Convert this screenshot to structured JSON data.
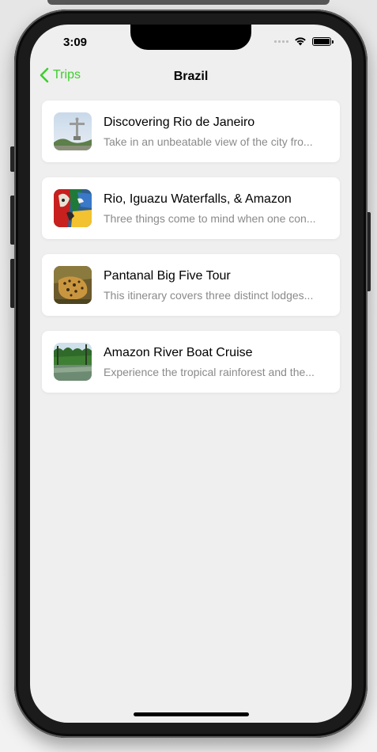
{
  "status_bar": {
    "time": "3:09"
  },
  "nav": {
    "back_label": "Trips",
    "title": "Brazil"
  },
  "trips": [
    {
      "title": "Discovering Rio de Janeiro",
      "description": "Take in an unbeatable view of the city fro...",
      "thumbnail": "christ-the-redeemer-image"
    },
    {
      "title": "Rio, Iguazu Waterfalls, & Amazon",
      "description": "Three things come to mind when one con...",
      "thumbnail": "macaw-parrots-image"
    },
    {
      "title": "Pantanal Big Five Tour",
      "description": "This itinerary covers three distinct lodges...",
      "thumbnail": "jaguar-image"
    },
    {
      "title": "Amazon River Boat Cruise",
      "description": "Experience the tropical rainforest and the...",
      "thumbnail": "amazon-river-image"
    }
  ],
  "colors": {
    "accent": "#3fce2f",
    "background": "#efefef",
    "card": "#ffffff",
    "secondary_text": "#8a8a8a"
  }
}
